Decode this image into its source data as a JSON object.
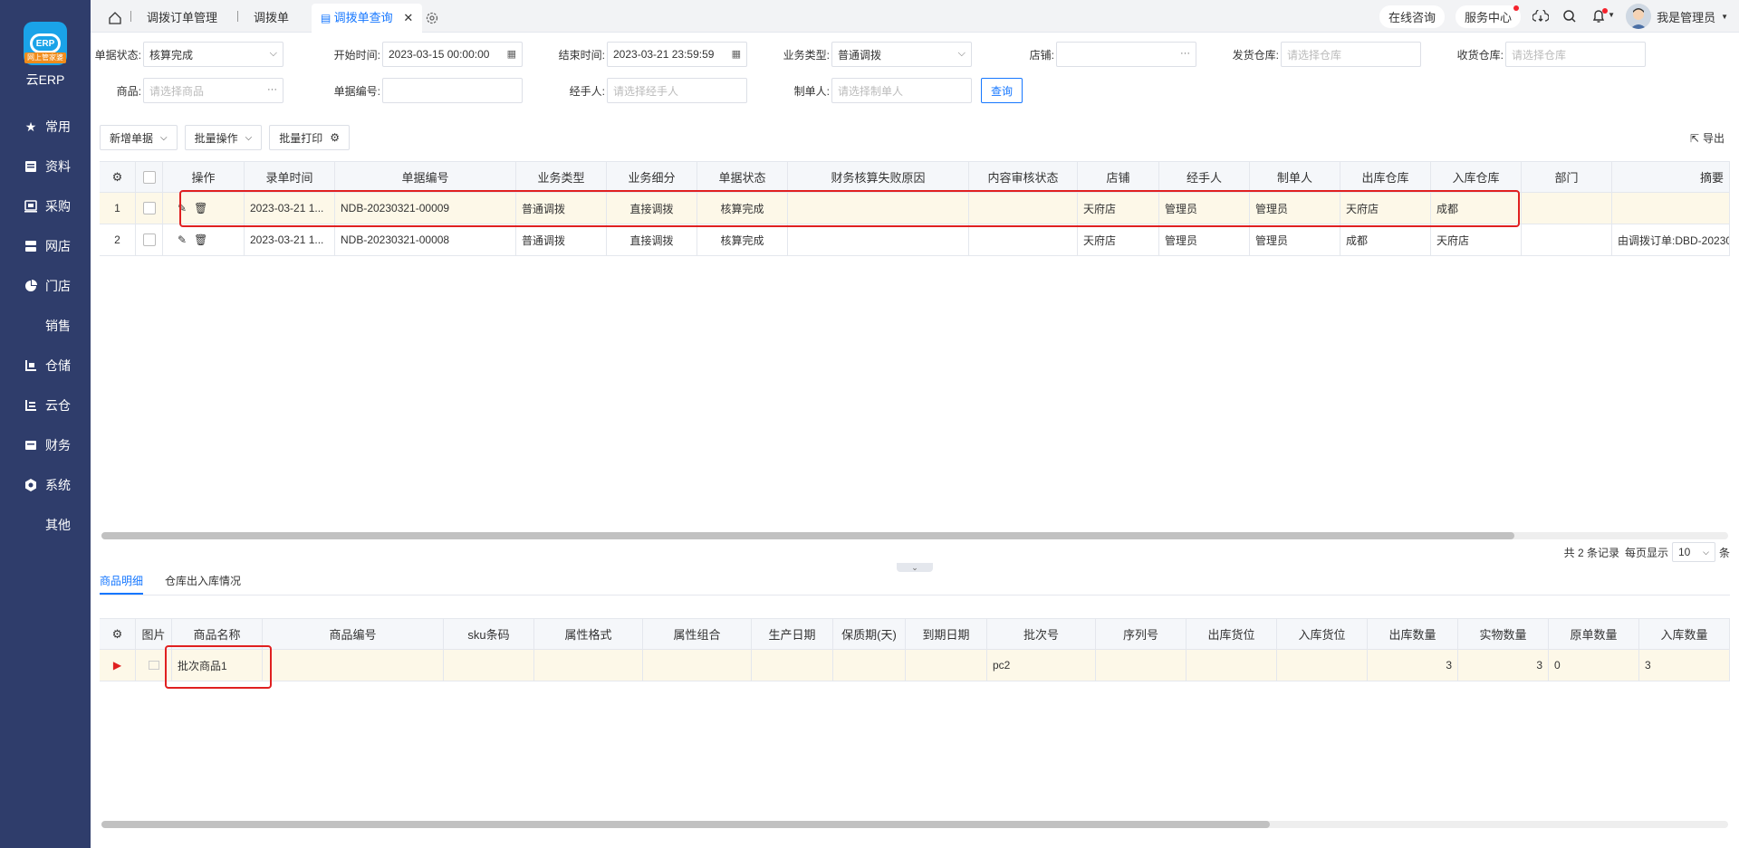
{
  "sidebar": {
    "brand": "云ERP",
    "logo_text": "ERP",
    "logo_band": "网上管家婆",
    "items": [
      {
        "label": "常用",
        "icon": "star-icon"
      },
      {
        "label": "资料",
        "icon": "document-icon"
      },
      {
        "label": "采购",
        "icon": "purchase-icon"
      },
      {
        "label": "网店",
        "icon": "online-store-icon"
      },
      {
        "label": "门店",
        "icon": "pie-chart-icon"
      },
      {
        "label": "销售",
        "icon": ""
      },
      {
        "label": "仓储",
        "icon": "warehouse-icon"
      },
      {
        "label": "云仓",
        "icon": "cloud-warehouse-icon"
      },
      {
        "label": "财务",
        "icon": "finance-icon"
      },
      {
        "label": "系统",
        "icon": "system-icon"
      },
      {
        "label": "其他",
        "icon": ""
      }
    ]
  },
  "tabs": {
    "items": [
      "调拨订单管理",
      "调拨单",
      "调拨单查询"
    ],
    "active": "调拨单查询"
  },
  "topbar": {
    "consult": "在线咨询",
    "service": "服务中心",
    "user": "我是管理员"
  },
  "filters": {
    "status_label": "单据状态:",
    "status_value": "核算完成",
    "start_label": "开始时间:",
    "start_value": "2023-03-15 00:00:00",
    "end_label": "结束时间:",
    "end_value": "2023-03-21 23:59:59",
    "biztype_label": "业务类型:",
    "biztype_value": "普通调拨",
    "shop_label": "店铺:",
    "send_wh_label": "发货仓库:",
    "send_wh_ph": "请选择仓库",
    "recv_wh_label": "收货仓库:",
    "recv_wh_ph": "请选择仓库",
    "goods_label": "商品:",
    "goods_ph": "请选择商品",
    "billno_label": "单据编号:",
    "handler_label": "经手人:",
    "handler_ph": "请选择经手人",
    "maker_label": "制单人:",
    "maker_ph": "请选择制单人",
    "query_button": "查询"
  },
  "toolbar": {
    "new_bill": "新增单据",
    "batch_ops": "批量操作",
    "batch_print": "批量打印",
    "export": "导出"
  },
  "main_table": {
    "columns": [
      "操作",
      "录单时间",
      "单据编号",
      "业务类型",
      "业务细分",
      "单据状态",
      "财务核算失败原因",
      "内容审核状态",
      "店铺",
      "经手人",
      "制单人",
      "出库仓库",
      "入库仓库",
      "部门",
      "摘要"
    ],
    "rows": [
      {
        "no": "1",
        "time": "2023-03-21 1...",
        "billno": "NDB-20230321-00009",
        "biztype": "普通调拨",
        "subtype": "直接调拨",
        "status": "核算完成",
        "fail": "",
        "audit": "",
        "shop": "天府店",
        "handler": "管理员",
        "maker": "管理员",
        "out_wh": "天府店",
        "in_wh": "成都",
        "dept": "",
        "memo": ""
      },
      {
        "no": "2",
        "time": "2023-03-21 1...",
        "billno": "NDB-20230321-00008",
        "biztype": "普通调拨",
        "subtype": "直接调拨",
        "status": "核算完成",
        "fail": "",
        "audit": "",
        "shop": "天府店",
        "handler": "管理员",
        "maker": "管理员",
        "out_wh": "成都",
        "in_wh": "天府店",
        "dept": "",
        "memo": "由调拨订单:DBD-20230"
      }
    ]
  },
  "pager": {
    "total": "共 2 条记录",
    "per_page_label": "每页显示",
    "per_page": "10",
    "unit": "条"
  },
  "subtabs": {
    "items": [
      "商品明细",
      "仓库出入库情况"
    ],
    "active": "商品明细"
  },
  "detail_table": {
    "columns": [
      "图片",
      "商品名称",
      "商品编号",
      "sku条码",
      "属性格式",
      "属性组合",
      "生产日期",
      "保质期(天)",
      "到期日期",
      "批次号",
      "序列号",
      "出库货位",
      "入库货位",
      "出库数量",
      "实物数量",
      "原单数量",
      "入库数量"
    ],
    "rows": [
      {
        "name": "批次商品1",
        "code": "",
        "sku": "",
        "fmt": "",
        "combo": "",
        "mfg": "",
        "shelf": "",
        "exp": "",
        "batch": "pc2",
        "serial": "",
        "out_loc": "",
        "in_loc": "",
        "out_qty": "3",
        "real_qty": "3",
        "orig_qty": "0",
        "in_qty": "3"
      }
    ]
  }
}
